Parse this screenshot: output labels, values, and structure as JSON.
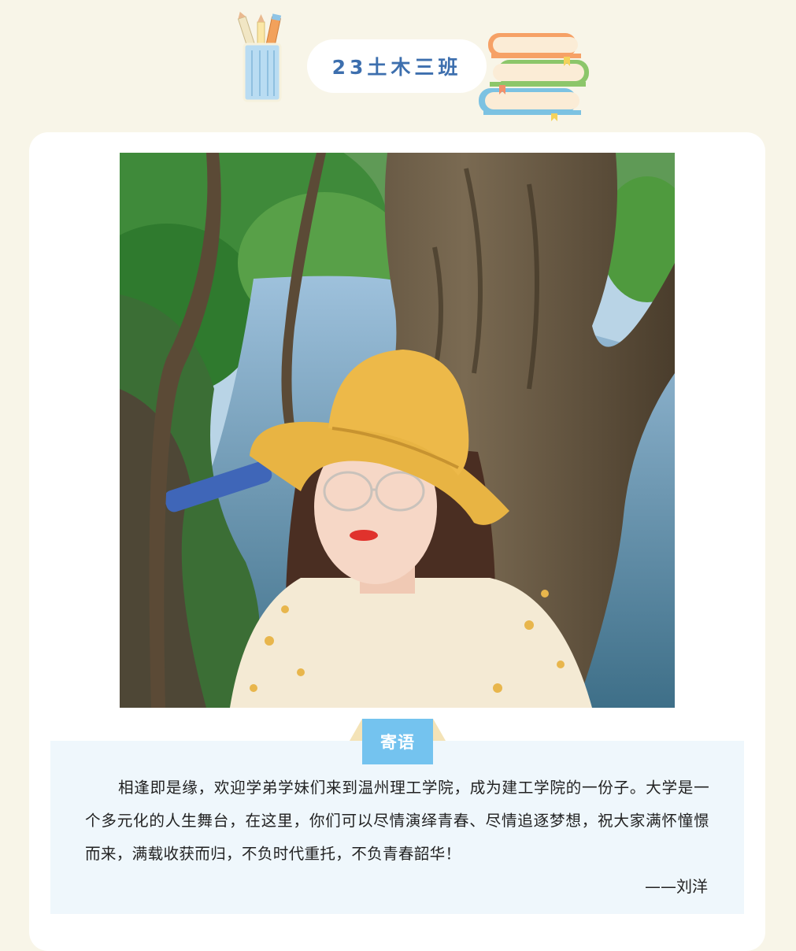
{
  "header": {
    "title": "23土木三班"
  },
  "message": {
    "tag_label": "寄语",
    "body": "相逢即是缘，欢迎学弟学妹们来到温州理工学院，成为建工学院的一份子。大学是一个多元化的人生舞台，在这里，你们可以尽情演绎青春、尽情追逐梦想，祝大家满怀憧憬而来，满载收获而归，不负时代重托，不负青春韶华！",
    "signature": "——刘洋"
  },
  "icons": {
    "pencil_cup": "pencil-cup-icon",
    "books": "book-stack-icon"
  },
  "colors": {
    "page_background": "#f8f5e8",
    "title_text": "#3d6fae",
    "tag_background": "#74c3ef",
    "message_background": "#eff7fc"
  }
}
